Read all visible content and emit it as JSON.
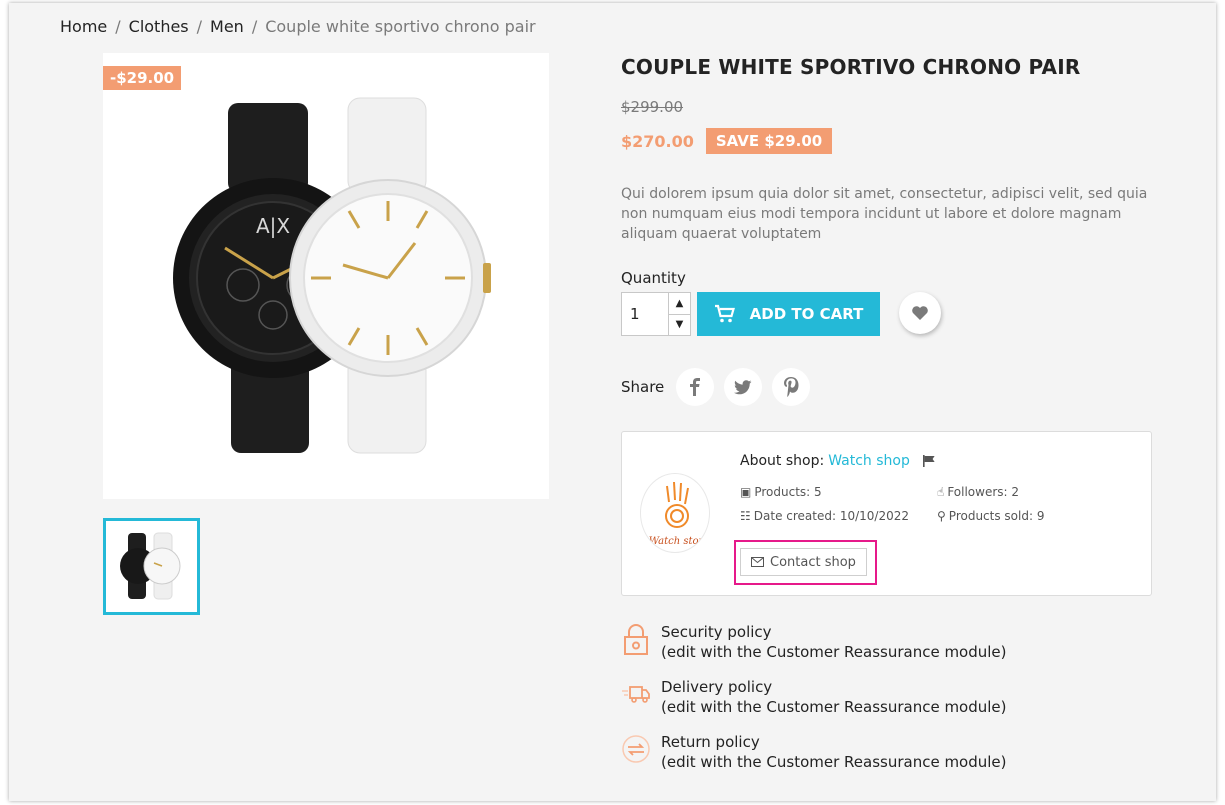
{
  "breadcrumb": {
    "items": [
      "Home",
      "Clothes",
      "Men"
    ],
    "separator": "/",
    "current": "Couple white sportivo chrono pair"
  },
  "product": {
    "discount_flag": "-$29.00",
    "title": "COUPLE WHITE SPORTIVO CHRONO PAIR",
    "old_price": "$299.00",
    "price": "$270.00",
    "save_badge": "SAVE $29.00",
    "description": "Qui dolorem ipsum quia dolor sit amet, consectetur, adipisci velit, sed quia non numquam eius modi tempora incidunt ut labore et dolore magnam aliquam quaerat voluptatem",
    "image_brand_text": "A|X"
  },
  "purchase": {
    "quantity_label": "Quantity",
    "quantity_value": "1",
    "add_to_cart_label": "ADD TO CART"
  },
  "share": {
    "label": "Share",
    "networks": [
      "facebook-icon",
      "twitter-icon",
      "pinterest-icon"
    ]
  },
  "shop": {
    "about_prefix": "About shop:",
    "name": "Watch shop",
    "products": "Products: 5",
    "followers": "Followers: 2",
    "date_created": "Date created: 10/10/2022",
    "products_sold": "Products sold: 9",
    "contact_label": "Contact shop",
    "logo_text": "Watch stor"
  },
  "policies": [
    {
      "title": "Security policy",
      "note": "(edit with the Customer Reassurance module)",
      "icon": "lock-icon"
    },
    {
      "title": "Delivery policy",
      "note": "(edit with the Customer Reassurance module)",
      "icon": "truck-icon"
    },
    {
      "title": "Return policy",
      "note": "(edit with the Customer Reassurance module)",
      "icon": "return-icon"
    }
  ],
  "colors": {
    "accent": "#24b9d7",
    "price": "#f39d72",
    "highlight": "#e6198a",
    "panel_bg": "#f4f4f4"
  }
}
